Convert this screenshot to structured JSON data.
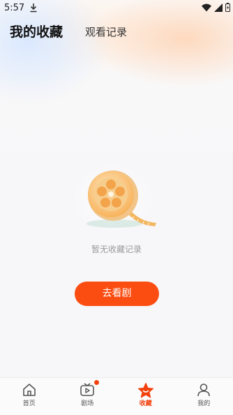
{
  "status_bar": {
    "time": "5:57"
  },
  "header": {
    "title": "我的收藏",
    "tab": "观看记录"
  },
  "empty_state": {
    "message": "暂无收藏记录",
    "button_label": "去看剧"
  },
  "tabbar": {
    "items": [
      {
        "label": "首页",
        "icon": "home-icon",
        "active": false
      },
      {
        "label": "剧场",
        "icon": "tv-icon",
        "active": false,
        "badge": true
      },
      {
        "label": "收藏",
        "icon": "star-icon",
        "active": true
      },
      {
        "label": "我的",
        "icon": "person-icon",
        "active": false
      }
    ]
  },
  "colors": {
    "accent": "#f2410d",
    "button": "#fb4d12"
  }
}
